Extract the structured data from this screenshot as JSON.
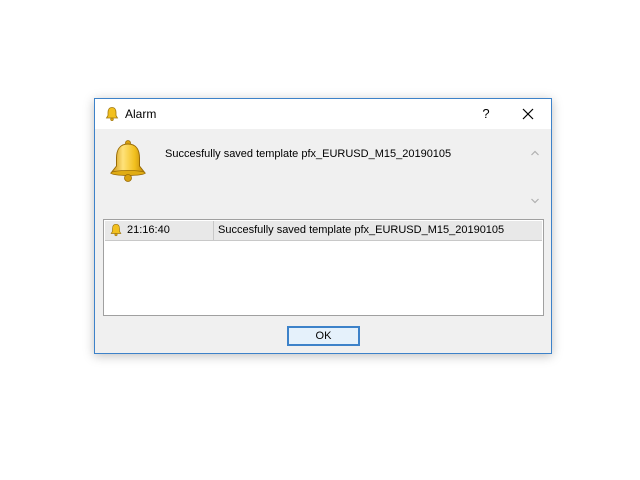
{
  "window": {
    "title": "Alarm",
    "help_label": "?",
    "icon": "bell-icon",
    "close_icon": "close-icon"
  },
  "message": {
    "text": "Succesfully saved template pfx_EURUSD_M15_20190105",
    "icon": "bell-icon"
  },
  "alarm_list": {
    "rows": [
      {
        "time": "21:16:40",
        "message": "Succesfully saved template pfx_EURUSD_M15_20190105",
        "icon": "bell-icon"
      }
    ]
  },
  "buttons": {
    "ok_label": "OK"
  },
  "colors": {
    "accent": "#3d82c9",
    "bell_gold": "#f2c01e",
    "dialog_bg": "#f0f0f0"
  }
}
